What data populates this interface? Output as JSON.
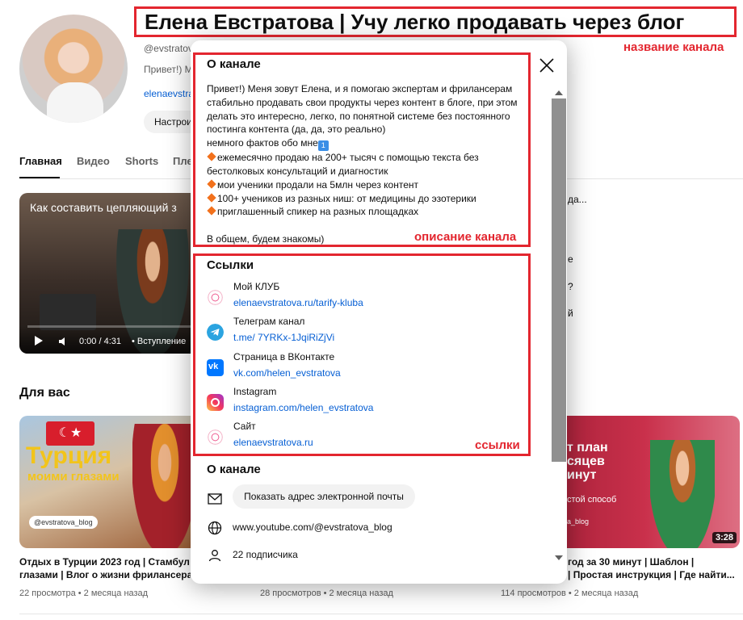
{
  "channel": {
    "title": "Елена Евстратова | Учу легко продавать через блог",
    "handle": "@evstratov",
    "desc_preview": "Привет!) М",
    "link_preview": "elenaevstra",
    "configure_btn": "Настрои"
  },
  "annotations": {
    "title_note": "название канала",
    "desc_note": "описание канала",
    "links_note": "ссылки"
  },
  "tabs": [
    "Главная",
    "Видео",
    "Shorts",
    "Пле"
  ],
  "featured_video": {
    "title": "Как составить цепляющий з",
    "time": "0:00 / 4:31",
    "chapter": "• Вступление"
  },
  "right_snippets": [
    "да...",
    "е",
    "?",
    "й"
  ],
  "for_you": {
    "heading": "Для вас",
    "videos": [
      {
        "thumb_big": "Турция",
        "thumb_sub": "моими глазами",
        "chip": "@evstratova_blog",
        "title1": "Отдых в Турции 2023 год | Стамбул мо",
        "title2": "глазами | Влог о жизни фрилансера",
        "meta": "22 просмотра • 2 месяца назад"
      },
      {
        "meta": "28 просмотров • 2 месяца назад"
      },
      {
        "thumb_a": "т план",
        "thumb_b": "сяцев",
        "thumb_c": "инут",
        "thumb_d": "стой способ",
        "thumb_e": "a_blog",
        "duration": "3:28",
        "title1": "год за 30 минут | Шаблон |",
        "title2": "| Простая инструкция | Где найти...",
        "meta": "114 просмотров • 2 месяца назад"
      }
    ]
  },
  "dialog": {
    "title": "О канале",
    "description": {
      "line1": "Привет!) Меня зовут Елена, и я помогаю экспертам и фрилансерам",
      "line2": "стабильно продавать свои продукты через контент в блоге, при этом",
      "line3": "делать это интересно, легко, по понятной системе без постоянного",
      "line4": "постинга контента (да, да, это реально)",
      "line5": "немного фактов обо мне",
      "one": "1",
      "b1a": "ежемесячно продаю на 200+ тысяч с помощью текста без",
      "b1b": "бестолковых консультаций и диагностик",
      "b2": "мои ученики продали на 5млн через контент",
      "b3": "100+ учеников из разных ниш: от медицины до эзотерики",
      "b4": "приглашенный спикер на разных площадках",
      "closing": "В общем, будем знакомы)"
    },
    "links_title": "Ссылки",
    "links": [
      {
        "label": "Мой КЛУБ",
        "url": "elenaevstratova.ru/tarify-kluba",
        "icon": "club-icon"
      },
      {
        "label": "Телеграм канал",
        "url": "t.me/ 7YRKx-1JqiRiZjVi",
        "icon": "telegram-icon"
      },
      {
        "label": "Страница в ВКонтакте",
        "url": "vk.com/helen_evstratova",
        "icon": "vk-icon"
      },
      {
        "label": "Instagram",
        "url": "instagram.com/helen_evstratova",
        "icon": "instagram-icon"
      },
      {
        "label": "Сайт",
        "url": "elenaevstratova.ru",
        "icon": "site-icon"
      }
    ],
    "about_title": "О канале",
    "email_btn": "Показать адрес электронной почты",
    "channel_url": "www.youtube.com/@evstratova_blog",
    "subscribers": "22 подписчика"
  },
  "colors": {
    "annotation": "#e3262f",
    "link": "#065fd4"
  }
}
